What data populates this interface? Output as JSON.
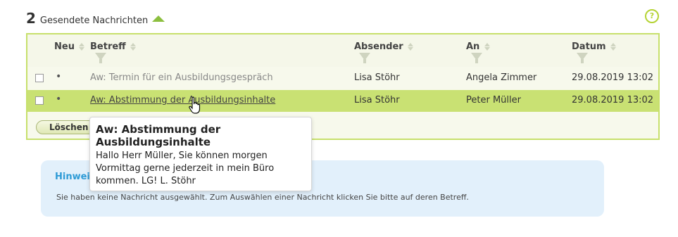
{
  "header": {
    "count": "2",
    "title": "Gesendete Nachrichten",
    "help_symbol": "?"
  },
  "table": {
    "columns": {
      "neu": "Neu",
      "betreff": "Betreff",
      "absender": "Absender",
      "an": "An",
      "datum": "Datum"
    },
    "rows": [
      {
        "new_marker": "•",
        "subject": "Aw: Termin für ein Ausbildungsgespräch",
        "sender": "Lisa Stöhr",
        "recipient": "Angela Zimmer",
        "date": "29.08.2019 13:02"
      },
      {
        "new_marker": "•",
        "subject": "Aw: Abstimmung der Ausbildungsinhalte",
        "sender": "Lisa Stöhr",
        "recipient": "Peter Müller",
        "date": "29.08.2019 13:02"
      }
    ],
    "delete_label": "Löschen"
  },
  "tooltip": {
    "title": "Aw: Abstimmung der Ausbildungsinhalte",
    "body": "Hallo Herr Müller, Sie können morgen Vormittag gerne jederzeit in mein Büro kommen. LG! L. Stöhr"
  },
  "hint": {
    "title": "Hinweis",
    "text": "Sie haben keine Nachricht ausgewählt. Zum Auswählen einer Nachricht klicken Sie bitte auf deren Betreff."
  },
  "colors": {
    "accent_green": "#c7e06b",
    "selected_row": "#c9e173",
    "hint_blue": "#2e9bd6",
    "hint_bg": "#e2f0fb"
  }
}
